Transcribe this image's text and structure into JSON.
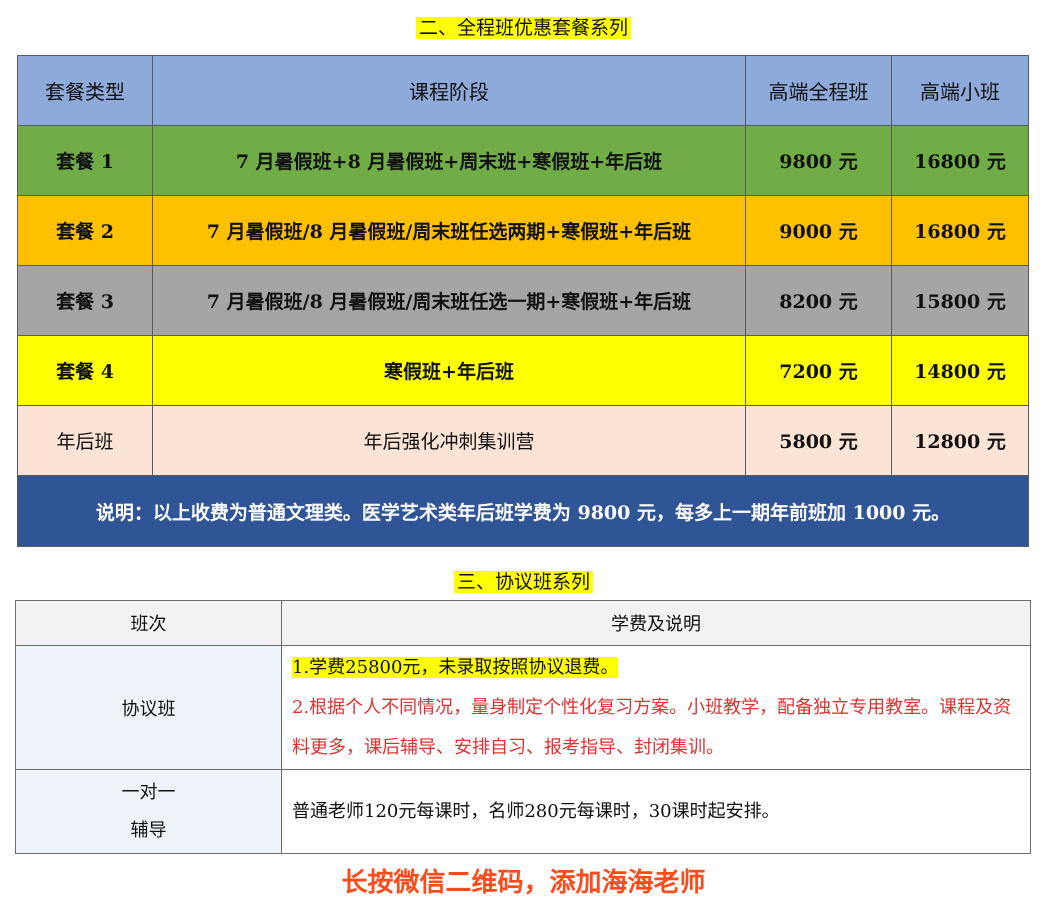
{
  "section2_title": "二、全程班优惠套餐系列",
  "package_table": {
    "headers": [
      "套餐类型",
      "课程阶段",
      "高端全程班",
      "高端小班"
    ],
    "rows": [
      {
        "type": "套餐 1",
        "stages": "7 月暑假班+8 月暑假班+周末班+寒假班+年后班",
        "full": "9800 元",
        "small": "16800 元",
        "color": "#70ad47"
      },
      {
        "type": "套餐 2",
        "stages": "7 月暑假班/8 月暑假班/周末班任选两期+寒假班+年后班",
        "full": "9000 元",
        "small": "16800 元",
        "color": "#ffc000"
      },
      {
        "type": "套餐 3",
        "stages": "7 月暑假班/8 月暑假班/周末班任选一期+寒假班+年后班",
        "full": "8200 元",
        "small": "15800 元",
        "color": "#a5a5a5"
      },
      {
        "type": "套餐 4",
        "stages": "寒假班+年后班",
        "full": "7200 元",
        "small": "14800 元",
        "color": "#ffff00"
      },
      {
        "type": "年后班",
        "stages": "年后强化冲刺集训营",
        "full": "5800 元",
        "small": "12800 元",
        "color": "#fbe4d5"
      }
    ],
    "note": "说明：以上收费为普通文理类。医学艺术类年后班学费为 9800 元，每多上一期年前班加 1000 元。"
  },
  "section3_title": "三、协议班系列",
  "protocol_table": {
    "headers": [
      "班次",
      "学费及说明"
    ],
    "rows": [
      {
        "name": "协议班",
        "line1": "1.学费25800元，未录取按照协议退费。",
        "line2": "2.根据个人不同情况，量身制定个性化复习方案。小班教学，配备独立专用教室。课程及资料更多，课后辅导、安排自习、报考指导、封闭集训。"
      },
      {
        "name_line1": "一对一",
        "name_line2": "辅导",
        "desc": "普通老师120元每课时，名师280元每课时，30课时起安排。"
      }
    ]
  },
  "footer_text": "长按微信二维码，添加海海老师"
}
